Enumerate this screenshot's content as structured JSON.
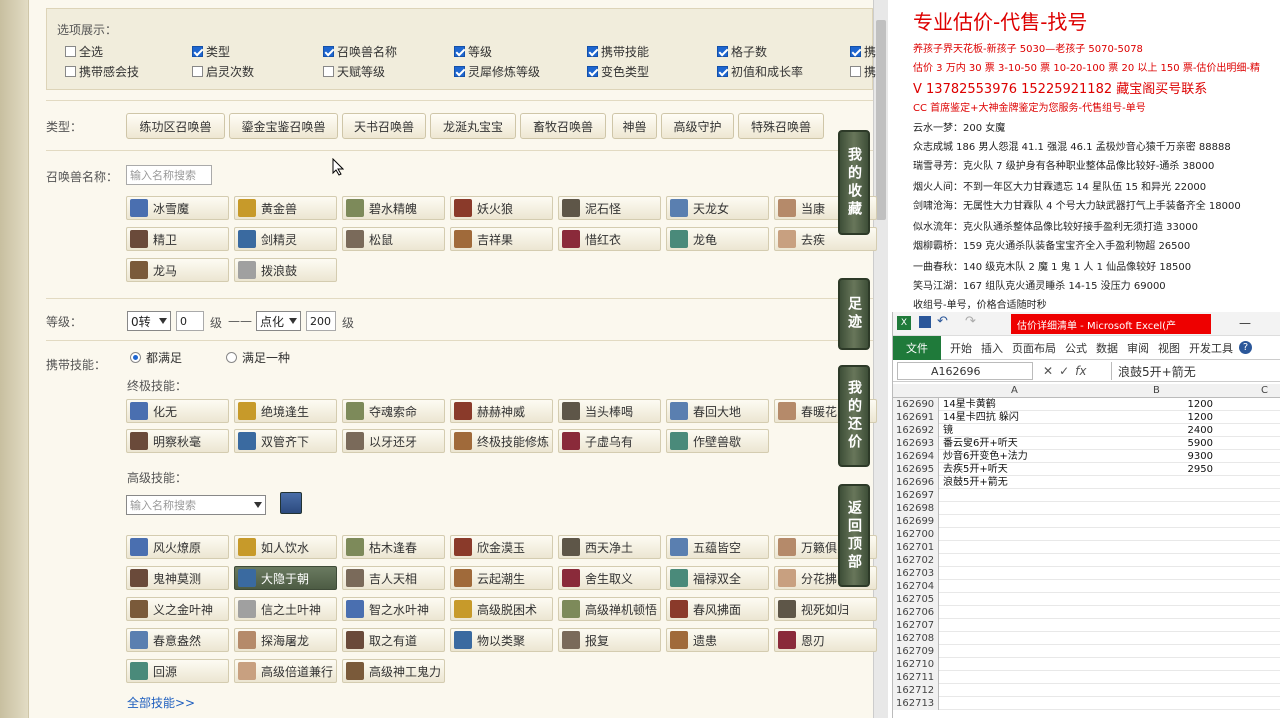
{
  "options": {
    "title": "选项展示：",
    "row1": [
      {
        "label": "全选",
        "checked": false
      },
      {
        "label": "类型",
        "checked": true
      },
      {
        "label": "召唤兽名称",
        "checked": true
      },
      {
        "label": "等级",
        "checked": true
      },
      {
        "label": "携带技能",
        "checked": true
      },
      {
        "label": "格子数",
        "checked": true
      },
      {
        "label": "携",
        "checked": true
      }
    ],
    "row2": [
      {
        "label": "携带感会技",
        "checked": false
      },
      {
        "label": "启灵次数",
        "checked": false
      },
      {
        "label": "天赋等级",
        "checked": false
      },
      {
        "label": "灵犀修炼等级",
        "checked": true
      },
      {
        "label": "变色类型",
        "checked": true
      },
      {
        "label": "初值和成长率",
        "checked": true
      },
      {
        "label": "携",
        "checked": false
      }
    ]
  },
  "type_filter": {
    "label": "类型：",
    "buttons": [
      "练功区召唤兽",
      "鎏金宝鉴召唤兽",
      "天书召唤兽",
      "龙涎丸宝宝",
      "畜牧召唤兽",
      "神兽",
      "高级守护",
      "特殊召唤兽"
    ]
  },
  "name_filter": {
    "label": "召唤兽名称：",
    "placeholder": "输入名称搜索",
    "pets": [
      "冰雪魔",
      "黄金兽",
      "碧水精魄",
      "妖火狼",
      "泥石怪",
      "天龙女",
      "当康",
      "精卫",
      "剑精灵",
      "松鼠",
      "吉祥果",
      "惜红衣",
      "龙龟",
      "去疾",
      "龙马",
      "拨浪鼓"
    ]
  },
  "level_filter": {
    "label": "等级：",
    "from_select": "0转",
    "from_value": "0",
    "unit1": "级",
    "dash": "——",
    "to_select": "点化",
    "to_value": "200",
    "unit2": "级"
  },
  "skill_filter": {
    "label": "携带技能：",
    "radio_all": "都满足",
    "radio_any": "满足一种",
    "ultimate_label": "终极技能：",
    "ultimate": [
      "化无",
      "绝境逢生",
      "夺魂索命",
      "赫赫神威",
      "当头棒喝",
      "春回大地",
      "春暖花",
      "明察秋毫",
      "双管齐下",
      "以牙还牙",
      "终极技能修炼",
      "子虚乌有",
      "作壁兽歇"
    ],
    "advanced_label": "高级技能：",
    "advanced_placeholder": "输入名称搜索",
    "advanced": [
      "风火燎原",
      "如人饮水",
      "枯木逢春",
      "欣金漠玉",
      "西天净土",
      "五蕴皆空",
      "万籁俱",
      "鬼神莫测",
      "大隐于朝",
      "吉人天相",
      "云起潮生",
      "舍生取义",
      "福禄双全",
      "分花拂",
      "义之金叶神",
      "信之土叶神",
      "智之水叶神",
      "高级脱困术",
      "高级禅机顿悟",
      "春风拂面",
      "视死如归",
      "春意盎然",
      "探海屠龙",
      "取之有道",
      "物以类聚",
      "报复",
      "遗患",
      "恩刃",
      "回源",
      "高级倍道兼行",
      "高级神工鬼力"
    ],
    "all_link": "全部技能>>"
  },
  "side_tabs": [
    "我的收藏",
    "足迹",
    "我的还价",
    "返回顶部"
  ],
  "notes": {
    "title": "专业估价-代售-找号",
    "lines": [
      {
        "text": "养孩子界天花板-新孩子 5030—老孩子 5070-5078",
        "style": "red"
      },
      {
        "text": "估价 3 万内 30 票  3-10-50 票  10-20-100 票  20 以上 150 票-估价出明细-精",
        "style": "red"
      },
      {
        "text": "V 13782553976   15225921182  藏宝阁买号联系",
        "style": "mid"
      },
      {
        "text": "CC 首席鉴定+大神金牌鉴定为您服务-代售组号-单号",
        "style": "red"
      },
      {
        "text": "云水一梦：200 女魔",
        "style": "black"
      },
      {
        "text": "众志成城 186 男人怨混 41.1 强混 46.1 孟极炒音心猿千万亲密 88888",
        "style": "black"
      },
      {
        "text": "瑞雪寻芳：克火队 7 级护身有各种职业整体品像比较好-通杀 38000",
        "style": "black"
      },
      {
        "text": "烟火人间：不到一年区大力甘霖遗忘 14 星队伍 15 和异光 22000",
        "style": "black"
      },
      {
        "text": "剑啸沧海：无属性大力甘霖队 4 个号大力缺武器打气上手装备齐全 18000",
        "style": "black"
      },
      {
        "text": "似水流年：克火队通杀整体品像比较好接手盈利无须打造 33000",
        "style": "black"
      },
      {
        "text": "烟柳霸桥：159 克火通杀队装备宝宝齐全入手盈利物超 26500",
        "style": "black"
      },
      {
        "text": "一曲春秋：140 级克木队 2 魔 1 鬼 1 人 1 仙品像较好 18500",
        "style": "black"
      },
      {
        "text": "笑马江湖：167 组队克火通灵睡杀 14-15 没压力 69000",
        "style": "black"
      },
      {
        "text": "收组号-单号，价格合适随时秒",
        "style": "black"
      }
    ]
  },
  "excel": {
    "title": "估价详细清单 - Microsoft Excel(产",
    "tabs": [
      "开始",
      "插入",
      "页面布局",
      "公式",
      "数据",
      "审阅",
      "视图",
      "开发工具"
    ],
    "file_tab": "文件",
    "cell_ref": "A162696",
    "formula": "浪鼓5开+箭无",
    "col_a": "A",
    "col_b": "B",
    "col_c": "C",
    "rows": [
      {
        "n": "162690",
        "a": "14星卡黄鹤",
        "b": "1200"
      },
      {
        "n": "162691",
        "a": "14星卡四抗 躲闪",
        "b": "1200"
      },
      {
        "n": "162692",
        "a": "镜",
        "b": "2400"
      },
      {
        "n": "162693",
        "a": "番云叟6开+听天",
        "b": "5900"
      },
      {
        "n": "162694",
        "a": "炒音6开变色+法力",
        "b": "9300"
      },
      {
        "n": "162695",
        "a": "去疾5开+听天",
        "b": "2950"
      },
      {
        "n": "162696",
        "a": "浪鼓5开+箭无",
        "b": ""
      },
      {
        "n": "162697",
        "a": "",
        "b": ""
      },
      {
        "n": "162698",
        "a": "",
        "b": ""
      },
      {
        "n": "162699",
        "a": "",
        "b": ""
      },
      {
        "n": "162700",
        "a": "",
        "b": ""
      },
      {
        "n": "162701",
        "a": "",
        "b": ""
      },
      {
        "n": "162702",
        "a": "",
        "b": ""
      },
      {
        "n": "162703",
        "a": "",
        "b": ""
      },
      {
        "n": "162704",
        "a": "",
        "b": ""
      },
      {
        "n": "162705",
        "a": "",
        "b": ""
      },
      {
        "n": "162706",
        "a": "",
        "b": ""
      },
      {
        "n": "162707",
        "a": "",
        "b": ""
      },
      {
        "n": "162708",
        "a": "",
        "b": ""
      },
      {
        "n": "162709",
        "a": "",
        "b": ""
      },
      {
        "n": "162710",
        "a": "",
        "b": ""
      },
      {
        "n": "162711",
        "a": "",
        "b": ""
      },
      {
        "n": "162712",
        "a": "",
        "b": ""
      },
      {
        "n": "162713",
        "a": "",
        "b": ""
      }
    ]
  },
  "colors": {
    "accent_red": "#dd0000",
    "excel_green": "#1f7a3a",
    "checkbox_blue": "#1e66d0",
    "sidetab": "#4d5c44"
  }
}
